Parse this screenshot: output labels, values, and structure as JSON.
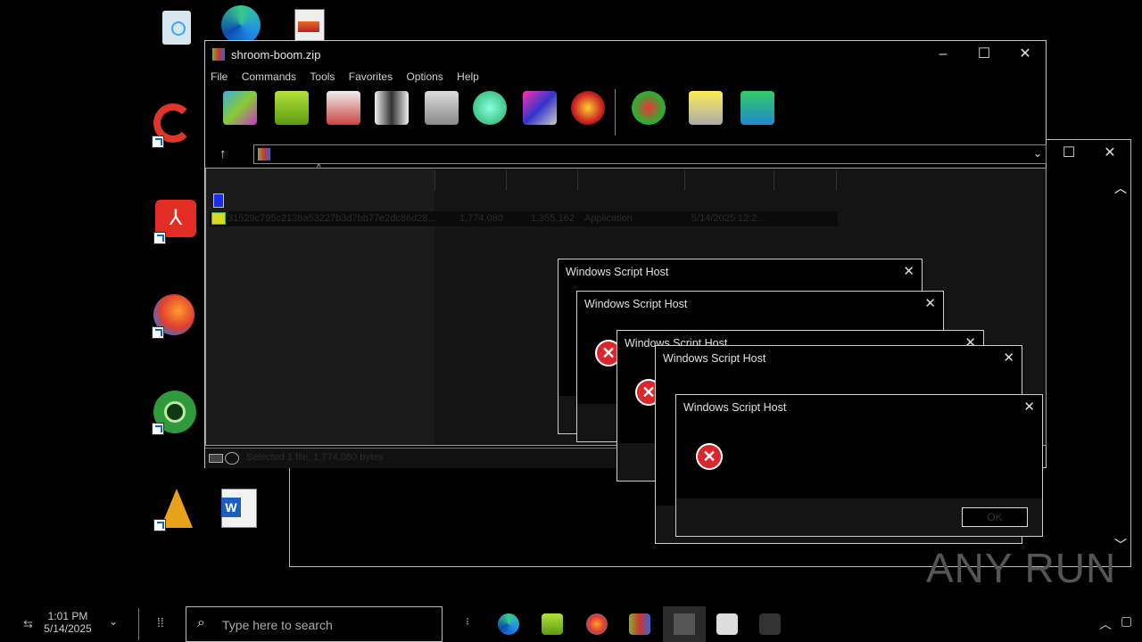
{
  "desktop": {
    "icons": [
      "recycle-bin-icon",
      "edge-icon",
      "image-file-icon",
      "ccleaner-icon",
      "acrobat-icon",
      "firefox-icon",
      "chrome-icon",
      "vlc-icon",
      "word-doc-icon"
    ]
  },
  "winrar": {
    "title": "shroom-boom.zip",
    "menu": [
      "File",
      "Commands",
      "Tools",
      "Favorites",
      "Options",
      "Help"
    ],
    "address": "",
    "row": {
      "name": "31529c795c2138a53227b3d7bb77e2dc86d28...",
      "size": "1,774,080",
      "packed": "1,355,162",
      "type": "Application",
      "modified": "5/14/2025 12:2..."
    },
    "status": "Selected 1 file, 1,774,080 bytes"
  },
  "dialogs": [
    {
      "title": "Windows Script Host"
    },
    {
      "title": "Windows Script Host"
    },
    {
      "title": "Windows Script Host"
    },
    {
      "title": "Windows Script Host"
    },
    {
      "title": "Windows Script Host",
      "button": "OK"
    }
  ],
  "taskbar": {
    "time": "1:01 PM",
    "date": "5/14/2025",
    "search_placeholder": "Type here to search"
  },
  "watermark": "ANY RUN"
}
